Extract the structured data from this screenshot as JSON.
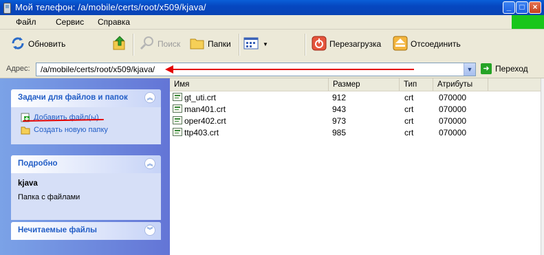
{
  "window": {
    "title": "Мой телефон: /a/mobile/certs/root/x509/kjava/"
  },
  "menu": {
    "items": [
      "Файл",
      "Сервис",
      "Справка"
    ]
  },
  "toolbar": {
    "refresh": "Обновить",
    "search": "Поиск",
    "folders": "Папки",
    "reboot": "Перезагрузка",
    "disconnect": "Отсоединить"
  },
  "address": {
    "label": "Адрес:",
    "value": "/a/mobile/certs/root/x509/kjava/",
    "go": "Переход"
  },
  "tasks_panel": {
    "title": "Задачи для файлов и папок",
    "items": [
      "Добавить файл(ы)",
      "Создать новую папку"
    ]
  },
  "details_panel": {
    "title": "Подробно",
    "name": "kjava",
    "type": "Папка с файлами"
  },
  "unread_panel": {
    "title": "Нечитаемые файлы"
  },
  "columns": {
    "name": "Имя",
    "size": "Размер",
    "type": "Тип",
    "attributes": "Атрибуты"
  },
  "files": [
    {
      "name": "gt_uti.crt",
      "size": "912",
      "type": "crt",
      "attributes": "070000"
    },
    {
      "name": "man401.crt",
      "size": "943",
      "type": "crt",
      "attributes": "070000"
    },
    {
      "name": "oper402.crt",
      "size": "973",
      "type": "crt",
      "attributes": "070000"
    },
    {
      "name": "ttp403.crt",
      "size": "985",
      "type": "crt",
      "attributes": "070000"
    }
  ]
}
